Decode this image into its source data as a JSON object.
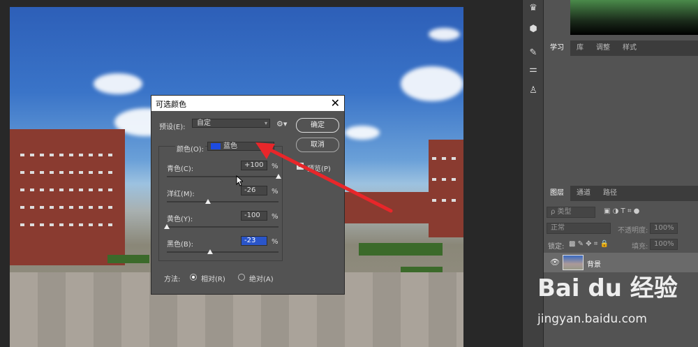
{
  "dialog": {
    "title": "可选颜色",
    "preset_label": "预设(E):",
    "preset_value": "自定",
    "ok_label": "确定",
    "cancel_label": "取消",
    "preview_label": "预览(P)",
    "color_label": "颜色(O):",
    "color_value": "蓝色",
    "color_swatch": "#1d4be0",
    "sliders": [
      {
        "label": "青色(C):",
        "value": "+100",
        "unit": "%",
        "position": 1.0
      },
      {
        "label": "洋红(M):",
        "value": "-26",
        "unit": "%",
        "position": 0.37
      },
      {
        "label": "黄色(Y):",
        "value": "-100",
        "unit": "%",
        "position": 0.0
      },
      {
        "label": "黑色(B):",
        "value": "-23",
        "unit": "%",
        "position": 0.385
      }
    ],
    "method_label": "方法:",
    "method_relative": "相对(R)",
    "method_absolute": "绝对(A)"
  },
  "panels": {
    "top_tabs": [
      "学习",
      "库",
      "调整",
      "样式"
    ],
    "layer_tabs": [
      "图层",
      "通道",
      "路径"
    ],
    "filter_kind": "ρ 类型",
    "blend_mode": "正常",
    "opacity_label": "不透明度:",
    "opacity_value": "100%",
    "lock_label": "锁定:",
    "fill_label": "填充:",
    "fill_value": "100%",
    "layer_name": "背景"
  },
  "watermark": {
    "logo_text": "Bai du 经验",
    "url": "jingyan.baidu.com"
  },
  "annotation_color": "#e8262a"
}
